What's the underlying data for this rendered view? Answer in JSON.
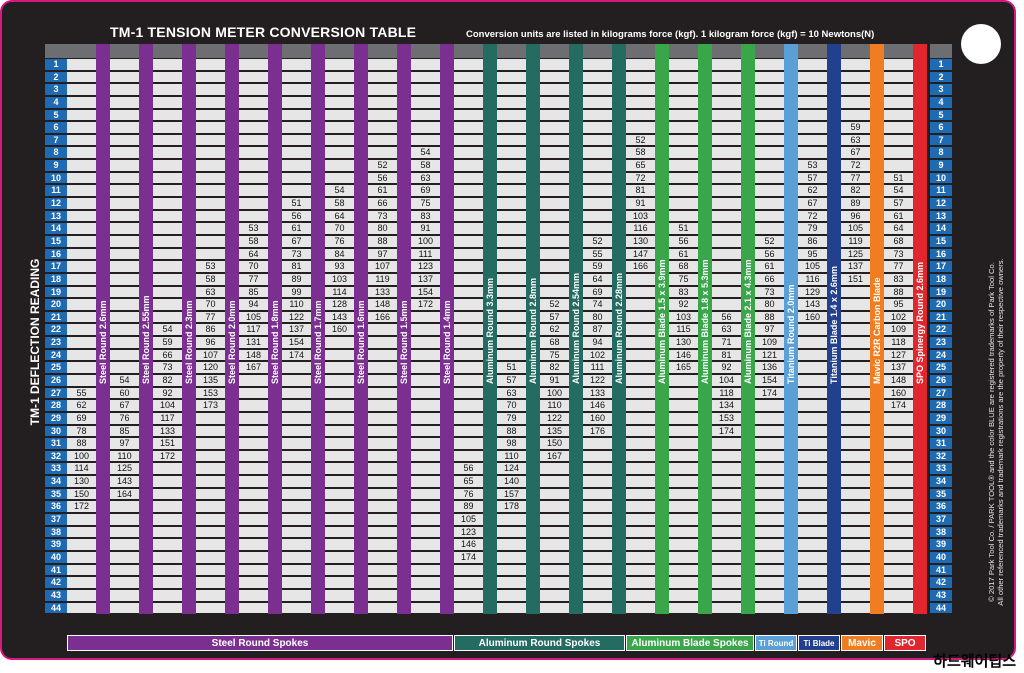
{
  "title": "TM-1 TENSION METER CONVERSION TABLE",
  "subtitle": "Conversion units are listed in kilograms force (kgf). 1 kilogram force (kgf) = 10 Newtons(N)",
  "y_axis_label": "TM-1 DEFLECTION READING",
  "legal_line1": "© 2017 Park Tool Co. / PARK TOOL® and the color BLUE are registered trademarks of Park Tool Co.",
  "legal_line2": "All other referenced trademarks and trademark registrations are the property of their respective owners.",
  "watermark": "하드웨어팁스",
  "deflection_readings": [
    "1",
    "2",
    "3",
    "4",
    "5",
    "6",
    "7",
    "8",
    "9",
    "10",
    "11",
    "12",
    "13",
    "14",
    "15",
    "16",
    "17",
    "18",
    "19",
    "20",
    "21",
    "22",
    "23",
    "24",
    "25",
    "26",
    "27",
    "28",
    "29",
    "30",
    "31",
    "32",
    "33",
    "34",
    "35",
    "36",
    "37",
    "38",
    "39",
    "40",
    "41",
    "42",
    "43",
    "44"
  ],
  "categories": [
    {
      "label": "Steel Round Spokes",
      "color": "#7b2f91"
    },
    {
      "label": "Aluminum Round Spokes",
      "color": "#246b62"
    },
    {
      "label": "Aluminum Blade Spokes",
      "color": "#3aa64a"
    },
    {
      "label": "Ti Round",
      "color": "#5a9fd6"
    },
    {
      "label": "Ti Blade",
      "color": "#23408f"
    },
    {
      "label": "Mavic",
      "color": "#f07d22"
    },
    {
      "label": "SPO",
      "color": "#e1262d"
    }
  ],
  "columns": [
    {
      "label": "Steel Round 2.6mm",
      "color": "#7b2f91",
      "start": 27,
      "values": [
        55,
        62,
        69,
        78,
        88,
        100,
        114,
        130,
        150,
        172
      ]
    },
    {
      "label": "Steel Round 2.55mm",
      "color": "#7b2f91",
      "start": 26,
      "values": [
        54,
        60,
        67,
        76,
        85,
        97,
        110,
        125,
        143,
        164
      ]
    },
    {
      "label": "Steel Round 2.3mm",
      "color": "#7b2f91",
      "start": 22,
      "values": [
        54,
        59,
        66,
        73,
        82,
        92,
        104,
        117,
        133,
        151,
        172
      ]
    },
    {
      "label": "Steel Round 2.0mm",
      "color": "#7b2f91",
      "start": 17,
      "values": [
        53,
        58,
        63,
        70,
        77,
        86,
        96,
        107,
        120,
        135,
        153,
        173
      ]
    },
    {
      "label": "Steel Round 1.8mm",
      "color": "#7b2f91",
      "start": 14,
      "values": [
        53,
        58,
        64,
        70,
        77,
        85,
        94,
        105,
        117,
        131,
        148,
        167
      ]
    },
    {
      "label": "Steel Round 1.7mm",
      "color": "#7b2f91",
      "start": 12,
      "values": [
        51,
        56,
        61,
        67,
        73,
        81,
        89,
        99,
        110,
        122,
        137,
        154,
        174
      ]
    },
    {
      "label": "Steel Round 1.6mm",
      "color": "#7b2f91",
      "start": 11,
      "values": [
        54,
        58,
        64,
        70,
        76,
        84,
        93,
        103,
        114,
        128,
        143,
        160
      ]
    },
    {
      "label": "Steel Round 1.5mm",
      "color": "#7b2f91",
      "start": 9,
      "values": [
        52,
        56,
        61,
        66,
        73,
        80,
        88,
        97,
        107,
        119,
        133,
        148,
        166
      ]
    },
    {
      "label": "Steel Round 1.4mm",
      "color": "#7b2f91",
      "start": 8,
      "values": [
        54,
        58,
        63,
        69,
        75,
        83,
        91,
        100,
        111,
        123,
        137,
        154,
        172
      ]
    },
    {
      "label": "Aluminum Round 3.3mm",
      "color": "#246b62",
      "start": 33,
      "values": [
        56,
        65,
        76,
        89,
        105,
        123,
        146,
        174
      ]
    },
    {
      "label": "Aluminum Round 2.8mm",
      "color": "#246b62",
      "start": 25,
      "values": [
        51,
        57,
        63,
        70,
        79,
        88,
        98,
        110,
        124,
        140,
        157,
        178
      ]
    },
    {
      "label": "Aluminum Round 2.54mm",
      "color": "#246b62",
      "start": 20,
      "values": [
        52,
        57,
        62,
        68,
        75,
        82,
        91,
        100,
        110,
        122,
        135,
        150,
        167
      ]
    },
    {
      "label": "Aluminum Round 2.28mm",
      "color": "#246b62",
      "start": 15,
      "values": [
        52,
        55,
        59,
        64,
        69,
        74,
        80,
        87,
        94,
        102,
        111,
        122,
        133,
        146,
        160,
        176
      ]
    },
    {
      "label": "Aluminum Blade 1.5 x 3.9mm",
      "color": "#3aa64a",
      "start": 7,
      "values": [
        52,
        58,
        65,
        72,
        81,
        91,
        103,
        116,
        130,
        147,
        166
      ]
    },
    {
      "label": "Aluminum Blade 1.8 x 5.3mm",
      "color": "#3aa64a",
      "start": 14,
      "values": [
        51,
        56,
        61,
        68,
        75,
        83,
        92,
        103,
        115,
        130,
        146,
        165
      ]
    },
    {
      "label": "Aluminum Blade 2.1 x 4.3mm",
      "color": "#3aa64a",
      "start": 21,
      "values": [
        56,
        63,
        71,
        81,
        92,
        104,
        118,
        134,
        153,
        174
      ]
    },
    {
      "label": "Titanium Round 2.0mm",
      "color": "#5a9fd6",
      "start": 15,
      "values": [
        52,
        56,
        61,
        66,
        73,
        80,
        88,
        97,
        109,
        121,
        136,
        154,
        174
      ]
    },
    {
      "label": "Titanium Blade 1.4 x 2.6mm",
      "color": "#23408f",
      "start": 9,
      "values": [
        53,
        57,
        62,
        67,
        72,
        79,
        86,
        95,
        105,
        116,
        129,
        143,
        160
      ]
    },
    {
      "label": "Mavic R2R Carbon Blade",
      "color": "#f07d22",
      "start": 6,
      "values": [
        59,
        63,
        67,
        72,
        77,
        82,
        89,
        96,
        105,
        119,
        125,
        137,
        151
      ]
    },
    {
      "label": "SPO Spinergy Round 2.6mm",
      "color": "#e1262d",
      "start": 10,
      "values": [
        51,
        54,
        57,
        61,
        64,
        68,
        73,
        77,
        83,
        88,
        95,
        102,
        109,
        118,
        127,
        137,
        148,
        160,
        174
      ]
    }
  ]
}
